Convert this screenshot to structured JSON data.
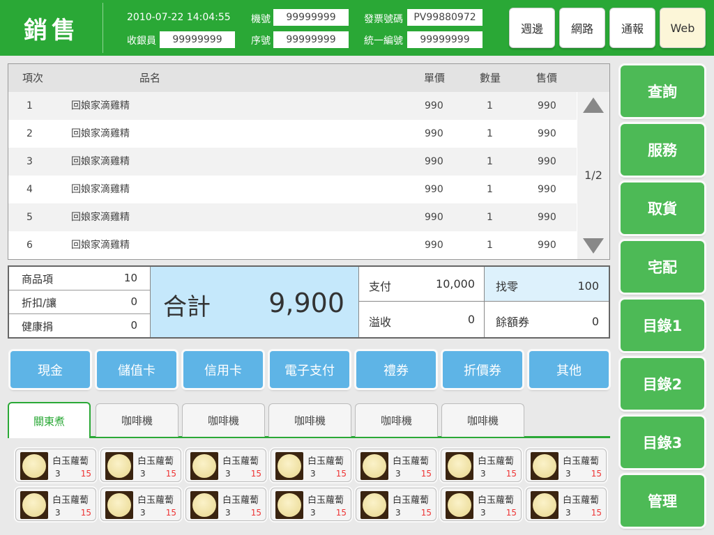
{
  "header": {
    "title": "銷售",
    "datetime": "2010-07-22  14:04:55",
    "cashier_label": "收銀員",
    "cashier_value": "99999999",
    "machine_label": "機號",
    "machine_value": "99999999",
    "serial_label": "序號",
    "serial_value": "99999999",
    "invoice_label": "發票號碼",
    "invoice_value": "PV99880972",
    "taxid_label": "統一編號",
    "taxid_value": "99999999",
    "buttons": [
      "週邊",
      "網路",
      "通報",
      "Web"
    ]
  },
  "table": {
    "columns": [
      "項次",
      "品名",
      "單價",
      "數量",
      "售價"
    ],
    "rows": [
      {
        "no": "1",
        "name": "回娘家滴雞精",
        "price": "990",
        "qty": "1",
        "amount": "990"
      },
      {
        "no": "2",
        "name": "回娘家滴雞精",
        "price": "990",
        "qty": "1",
        "amount": "990"
      },
      {
        "no": "3",
        "name": "回娘家滴雞精",
        "price": "990",
        "qty": "1",
        "amount": "990"
      },
      {
        "no": "4",
        "name": "回娘家滴雞精",
        "price": "990",
        "qty": "1",
        "amount": "990"
      },
      {
        "no": "5",
        "name": "回娘家滴雞精",
        "price": "990",
        "qty": "1",
        "amount": "990"
      },
      {
        "no": "6",
        "name": "回娘家滴雞精",
        "price": "990",
        "qty": "1",
        "amount": "990"
      }
    ],
    "page_indicator": "1/2"
  },
  "summary": {
    "items_label": "商品項",
    "items_value": "10",
    "discount_label": "折扣/讓",
    "discount_value": "0",
    "health_label": "健康捐",
    "health_value": "0",
    "total_label": "合計",
    "total_value": "9,900",
    "paid_label": "支付",
    "paid_value": "10,000",
    "overpay_label": "溢收",
    "overpay_value": "0",
    "change_label": "找零",
    "change_value": "100",
    "voucher_label": "餘額券",
    "voucher_value": "0"
  },
  "payment_buttons": [
    "現金",
    "儲值卡",
    "信用卡",
    "電子支付",
    "禮券",
    "折價券",
    "其他"
  ],
  "tabs": [
    "關東煮",
    "咖啡機",
    "咖啡機",
    "咖啡機",
    "咖啡機",
    "咖啡機"
  ],
  "products": [
    {
      "name": "白玉蘿蔔",
      "qty": "3",
      "price": "15"
    },
    {
      "name": "白玉蘿蔔",
      "qty": "3",
      "price": "15"
    },
    {
      "name": "白玉蘿蔔",
      "qty": "3",
      "price": "15"
    },
    {
      "name": "白玉蘿蔔",
      "qty": "3",
      "price": "15"
    },
    {
      "name": "白玉蘿蔔",
      "qty": "3",
      "price": "15"
    },
    {
      "name": "白玉蘿蔔",
      "qty": "3",
      "price": "15"
    },
    {
      "name": "白玉蘿蔔",
      "qty": "3",
      "price": "15"
    },
    {
      "name": "白玉蘿蔔",
      "qty": "3",
      "price": "15"
    },
    {
      "name": "白玉蘿蔔",
      "qty": "3",
      "price": "15"
    },
    {
      "name": "白玉蘿蔔",
      "qty": "3",
      "price": "15"
    },
    {
      "name": "白玉蘿蔔",
      "qty": "3",
      "price": "15"
    },
    {
      "name": "白玉蘿蔔",
      "qty": "3",
      "price": "15"
    },
    {
      "name": "白玉蘿蔔",
      "qty": "3",
      "price": "15"
    },
    {
      "name": "白玉蘿蔔",
      "qty": "3",
      "price": "15"
    }
  ],
  "side_buttons": [
    "查詢",
    "服務",
    "取貨",
    "宅配",
    "目錄1",
    "目錄2",
    "目錄3",
    "管理"
  ],
  "colors": {
    "brand_green": "#2aa836",
    "pay_blue": "#5eb4e6",
    "total_bg": "#c5e8fb",
    "price_red": "#e33333"
  }
}
